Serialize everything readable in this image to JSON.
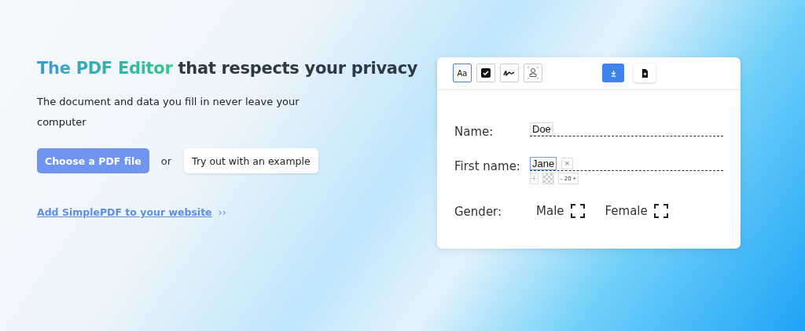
{
  "hero": {
    "headline": {
      "highlight": "The PDF Editor",
      "text": "that respects your privacy"
    },
    "subtitle": "The document and data you fill in never leave your computer",
    "primary_button": "Choose a PDF file",
    "separator": "or",
    "secondary_button": "Try out with an example",
    "link": {
      "label": "Add SimplePDF to your website",
      "arrow": "››"
    }
  },
  "editor": {
    "tools": [
      {
        "kind": "text",
        "label": "Aa",
        "selected": true
      },
      {
        "kind": "checkbox",
        "selected": false
      },
      {
        "kind": "signature",
        "selected": false
      },
      {
        "kind": "stamp",
        "selected": false
      }
    ],
    "fields": [
      {
        "kind": "text",
        "label": "Name:",
        "value": "Doe",
        "focused": false
      },
      {
        "kind": "text",
        "label": "First name:",
        "value": "Jane",
        "focused": true,
        "close": "×",
        "font_size": "20",
        "decrease": "-",
        "increase": "+"
      },
      {
        "kind": "options",
        "label": "Gender:",
        "options": [
          {
            "label": "Male",
            "checked": false
          },
          {
            "label": "Female",
            "checked": false
          }
        ]
      }
    ]
  }
}
